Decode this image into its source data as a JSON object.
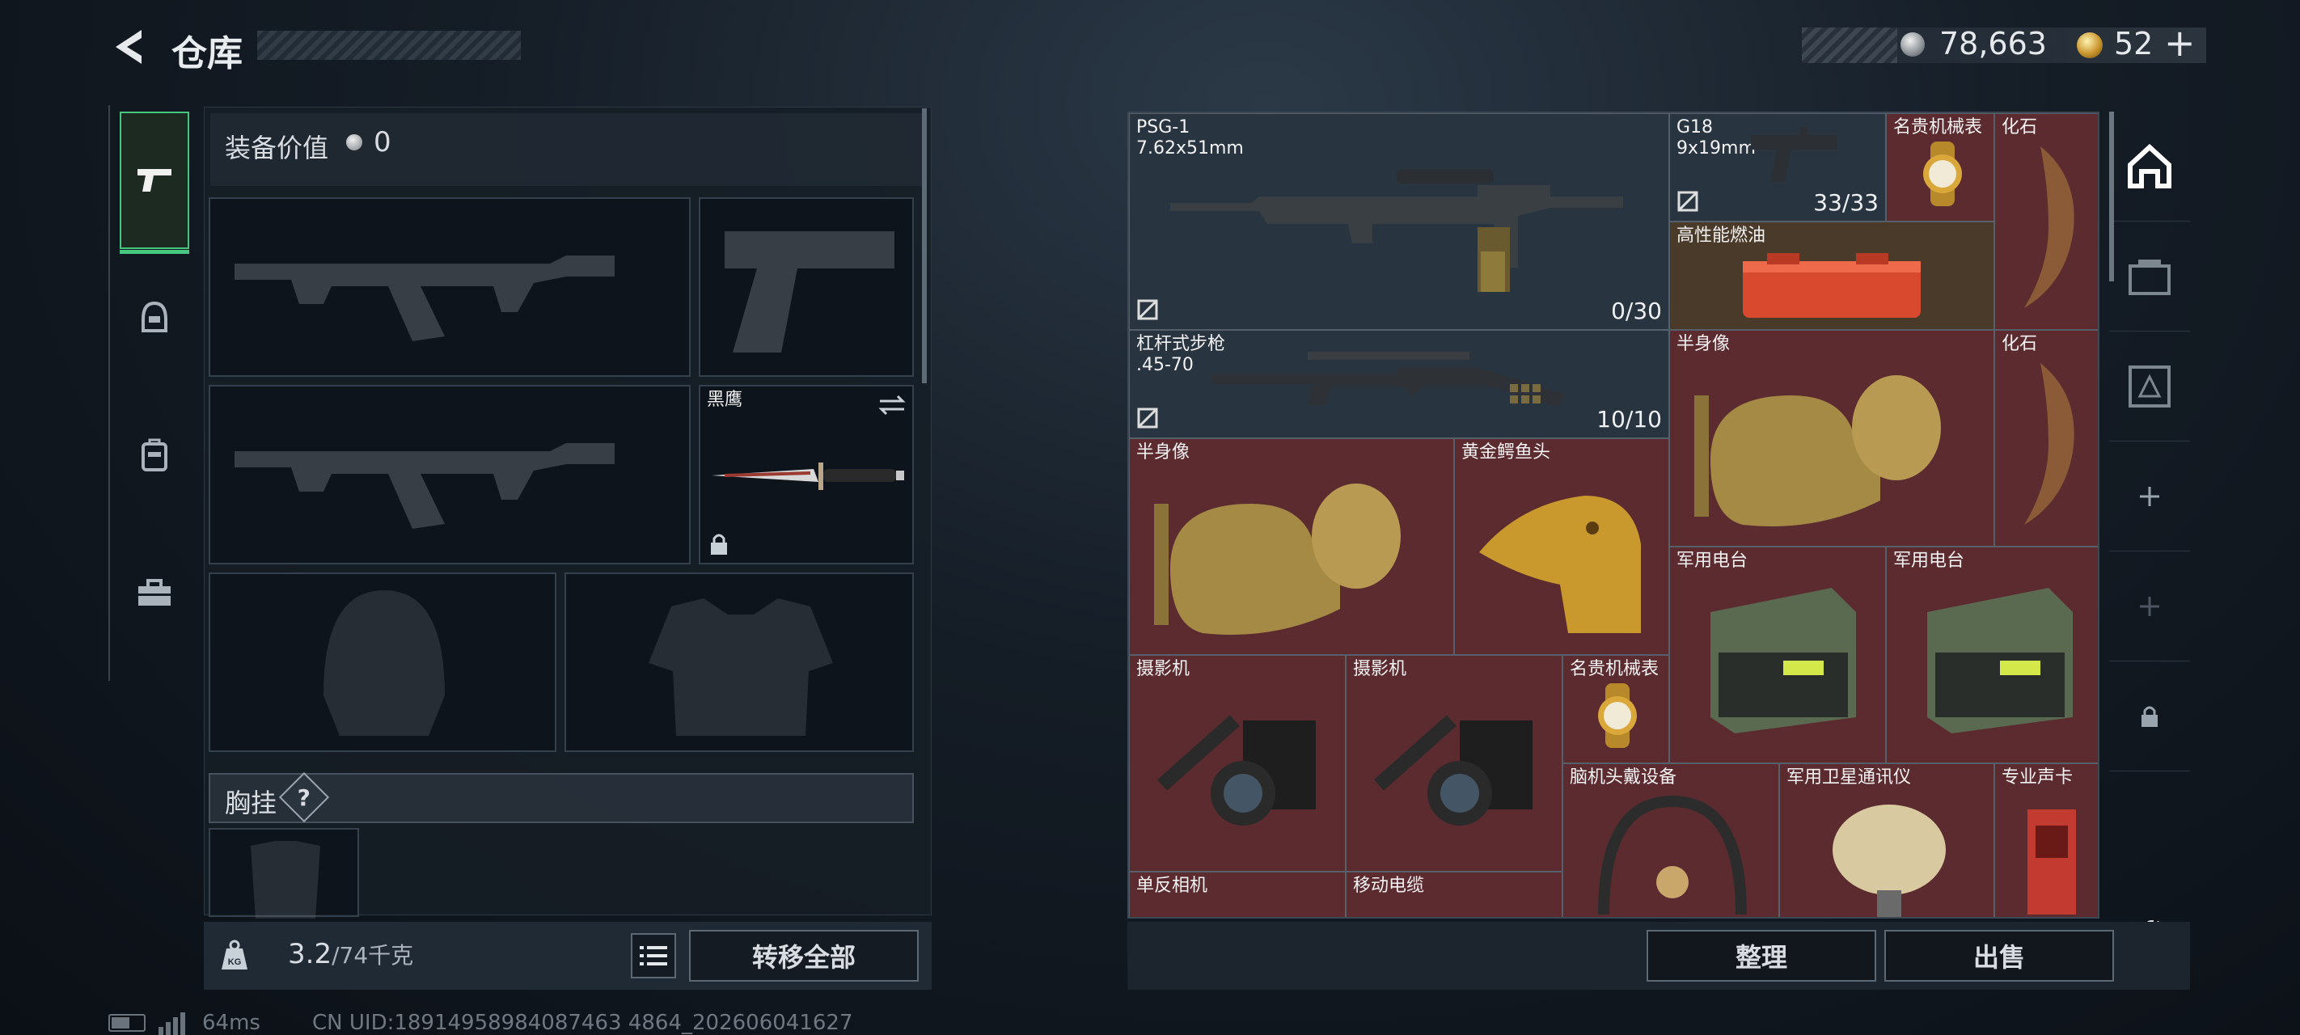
{
  "header": {
    "title": "仓库",
    "back_icon": "chevron-left-icon"
  },
  "currency": {
    "silver": "78,663",
    "gold": "52",
    "gold_plus": "+"
  },
  "left_tabs": [
    {
      "icon": "pistol-icon",
      "active": true
    },
    {
      "icon": "helmet-icon",
      "active": false
    },
    {
      "icon": "backpack-icon",
      "active": false
    },
    {
      "icon": "toolbox-icon",
      "active": false
    }
  ],
  "equipment": {
    "value_label": "装备价值",
    "value": "0",
    "knife_name": "黑鹰"
  },
  "chest": {
    "label": "胸挂",
    "help": "?"
  },
  "weight": {
    "current": "3.2",
    "max": "/74千克",
    "icon_text": "KG"
  },
  "buttons": {
    "transfer_all": "转移全部",
    "sort": "整理",
    "sell": "出售"
  },
  "grid_items": [
    {
      "name": "PSG-1\n7.62x51mm",
      "count": "0/30",
      "color": "gray"
    },
    {
      "name": "G18\n9x19mm",
      "count": "33/33",
      "color": "gray"
    },
    {
      "name": "名贵机械表",
      "color": "red"
    },
    {
      "name": "化石",
      "color": "red"
    },
    {
      "name": "高性能燃油",
      "color": "orange"
    },
    {
      "name": "杠杆式步枪\n.45-70",
      "count": "10/10",
      "color": "gray"
    },
    {
      "name": "半身像",
      "color": "red"
    },
    {
      "name": "化石",
      "color": "red"
    },
    {
      "name": "半身像",
      "color": "red"
    },
    {
      "name": "黄金鳄鱼头",
      "color": "red"
    },
    {
      "name": "军用电台",
      "color": "red"
    },
    {
      "name": "军用电台",
      "color": "red"
    },
    {
      "name": "摄影机",
      "color": "red"
    },
    {
      "name": "摄影机",
      "color": "red"
    },
    {
      "name": "名贵机械表",
      "color": "red"
    },
    {
      "name": "脑机头戴设备",
      "color": "red"
    },
    {
      "name": "军用卫星通讯仪",
      "color": "red"
    },
    {
      "name": "专业声卡",
      "color": "red"
    },
    {
      "name": "单反相机",
      "color": "red"
    },
    {
      "name": "移动电缆",
      "color": "red"
    }
  ],
  "right_tabs": [
    "house-icon",
    "container-icon",
    "safe-icon",
    "plus-icon",
    "plus-icon",
    "lock-icon"
  ],
  "status": {
    "ping": "64ms",
    "uid": "CN UID:18914958984087463 4864_202606041627"
  }
}
